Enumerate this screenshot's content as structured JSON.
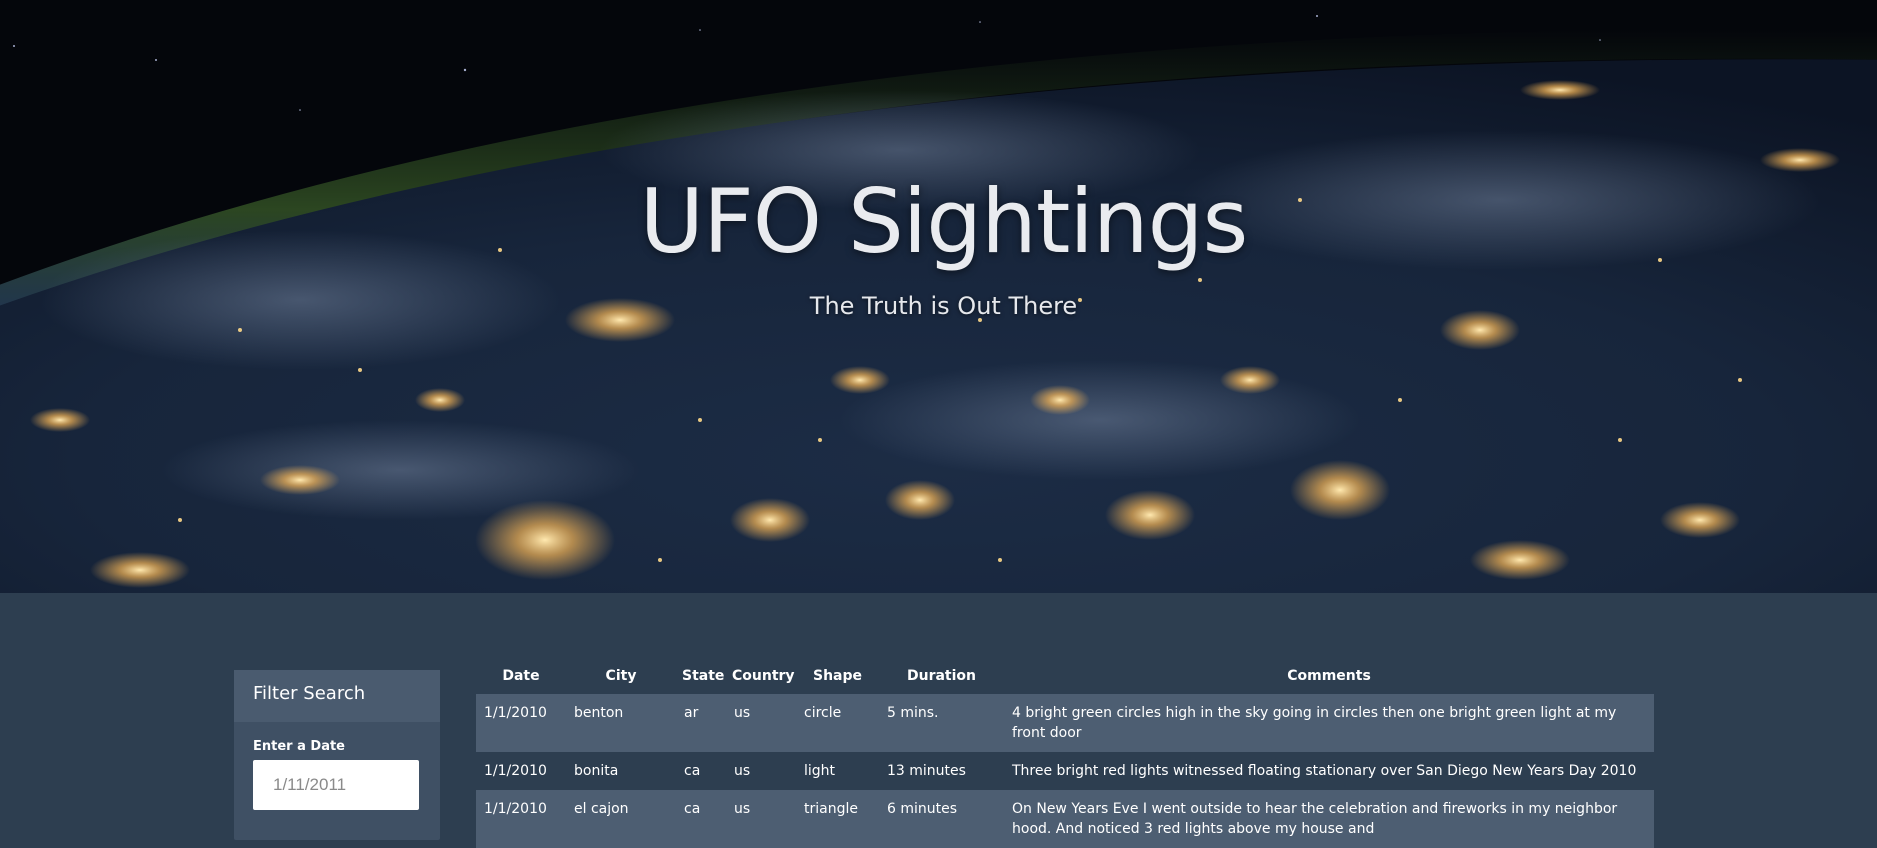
{
  "hero": {
    "title": "UFO Sightings",
    "subtitle": "The Truth is Out There"
  },
  "filter": {
    "heading": "Filter Search",
    "date_label": "Enter a Date",
    "date_placeholder": "1/11/2011"
  },
  "table": {
    "headers": [
      "Date",
      "City",
      "State",
      "Country",
      "Shape",
      "Duration",
      "Comments"
    ],
    "rows": [
      {
        "date": "1/1/2010",
        "city": "benton",
        "state": "ar",
        "country": "us",
        "shape": "circle",
        "duration": "5 mins.",
        "comments": "4 bright green circles high in the sky going in circles then one bright green light at my front door"
      },
      {
        "date": "1/1/2010",
        "city": "bonita",
        "state": "ca",
        "country": "us",
        "shape": "light",
        "duration": "13 minutes",
        "comments": "Three bright red lights witnessed floating stationary over San Diego New Years Day 2010"
      },
      {
        "date": "1/1/2010",
        "city": "el cajon",
        "state": "ca",
        "country": "us",
        "shape": "triangle",
        "duration": "6 minutes",
        "comments": "On New Years Eve I went outside to hear the celebration and fireworks in my neighbor hood. And noticed 3 red lights above my house and"
      }
    ]
  },
  "colors": {
    "page_background": "#2d3e50",
    "row_striped": "#4d5e72",
    "panel_background": "#3f5064",
    "panel_heading": "#4a5b6f"
  }
}
